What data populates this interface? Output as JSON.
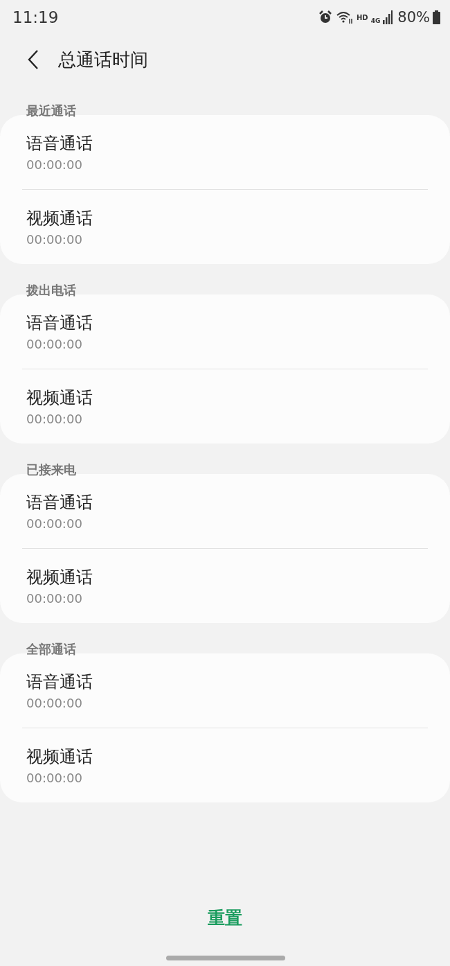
{
  "status_bar": {
    "time": "11:19",
    "hd": "HD",
    "network": "4G",
    "battery": "80%"
  },
  "header": {
    "title": "总通话时间"
  },
  "sections": [
    {
      "title": "最近通话",
      "rows": [
        {
          "label": "语音通话",
          "value": "00:00:00"
        },
        {
          "label": "视频通话",
          "value": "00:00:00"
        }
      ]
    },
    {
      "title": "拨出电话",
      "rows": [
        {
          "label": "语音通话",
          "value": "00:00:00"
        },
        {
          "label": "视频通话",
          "value": "00:00:00"
        }
      ]
    },
    {
      "title": "已接来电",
      "rows": [
        {
          "label": "语音通话",
          "value": "00:00:00"
        },
        {
          "label": "视频通话",
          "value": "00:00:00"
        }
      ]
    },
    {
      "title": "全部通话",
      "rows": [
        {
          "label": "语音通话",
          "value": "00:00:00"
        },
        {
          "label": "视频通话",
          "value": "00:00:00"
        }
      ]
    }
  ],
  "reset_button": "重置"
}
